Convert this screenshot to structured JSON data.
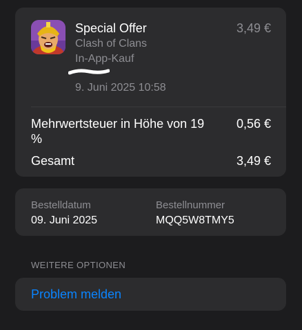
{
  "purchase": {
    "title": "Special Offer",
    "app_name": "Clash of Clans",
    "type": "In-App-Kauf",
    "date": "9. Juni 2025 10:58",
    "price": "3,49 €",
    "icon": "clash-of-clans-app-icon",
    "tax_label": "Mehrwertsteuer in Höhe von 19 %",
    "tax_value": "0,56 €",
    "total_label": "Gesamt",
    "total_value": "3,49 €"
  },
  "order": {
    "date_label": "Bestelldatum",
    "date_value": "09. Juni 2025",
    "number_label": "Bestellnummer",
    "number_value": "MQQ5W8TMY5"
  },
  "options": {
    "header": "WEITERE OPTIONEN",
    "report_problem": "Problem melden"
  },
  "colors": {
    "background": "#1c1c1e",
    "card": "#2c2c2e",
    "secondary_text": "#8e8e93",
    "link": "#0a84ff"
  }
}
